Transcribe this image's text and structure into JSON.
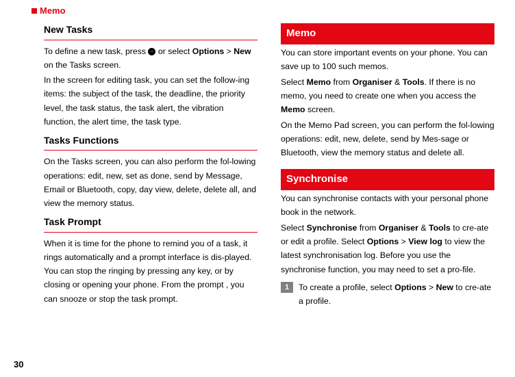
{
  "header": {
    "label": "Memo"
  },
  "left": {
    "h1": "New Tasks",
    "p1a": "To define a new task, press ",
    "p1b": " or select ",
    "p1_opt": "Options",
    "p1_gt": " > ",
    "p1_new": "New",
    "p1c": " on the Tasks screen.",
    "p2": "In the screen for editing task, you can set the follow-ing items: the subject of the task, the deadline, the priority level, the task status, the task alert, the vibration function, the alert time, the task type.",
    "h2": "Tasks  Functions",
    "p3": "On the Tasks screen, you can also perform the fol-lowing operations: edit, new, set as done, send by Message, Email or Bluetooth, copy, day view, delete, delete all, and view the memory status.",
    "h3": "Task Prompt",
    "p4": "When it is time for the phone to remind you of a task, it rings automatically and a prompt interface is dis-played. You can stop the ringing by pressing any key, or by closing or opening your phone. From the prompt , you can snooze or stop the task prompt."
  },
  "right": {
    "bar1": "Memo",
    "m1": "You can store important events on your phone. You can save up to 100 such memos.",
    "m2a": "Select ",
    "m2_memo": "Memo",
    "m2b": " from ",
    "m2_org": "Organiser",
    "m2c": " & ",
    "m2_tools": "Tools",
    "m2d": ". If there is no memo, you need to create one when you access the ",
    "m2_memo2": "Memo",
    "m2e": " screen.",
    "m3": "On the Memo Pad screen, you can perform the fol-lowing operations: edit, new, delete, send by Mes-sage or Bluetooth, view the memory status and delete all.",
    "bar2": "Synchronise",
    "s1": "You can synchronise contacts with your personal phone book in the network.",
    "s2a": "Select ",
    "s2_sync": "Synchronise",
    "s2b": " from ",
    "s2_org": "Organiser",
    "s2c": " & ",
    "s2_tools": "Tools",
    "s2d": " to cre-ate or edit a profile. Select ",
    "s2_opt": "Options",
    "s2e": " > ",
    "s2_vl": "View log",
    "s2f": " to view the latest synchronisation log. Before you use the synchronise function, you may need to set a pro-file.",
    "step1_num": "1",
    "step1a": "To create a profile, select ",
    "step1_opt": "Options",
    "step1b": " > ",
    "step1_new": "New",
    "step1c": " to cre-ate a profile."
  },
  "page_num": "30"
}
